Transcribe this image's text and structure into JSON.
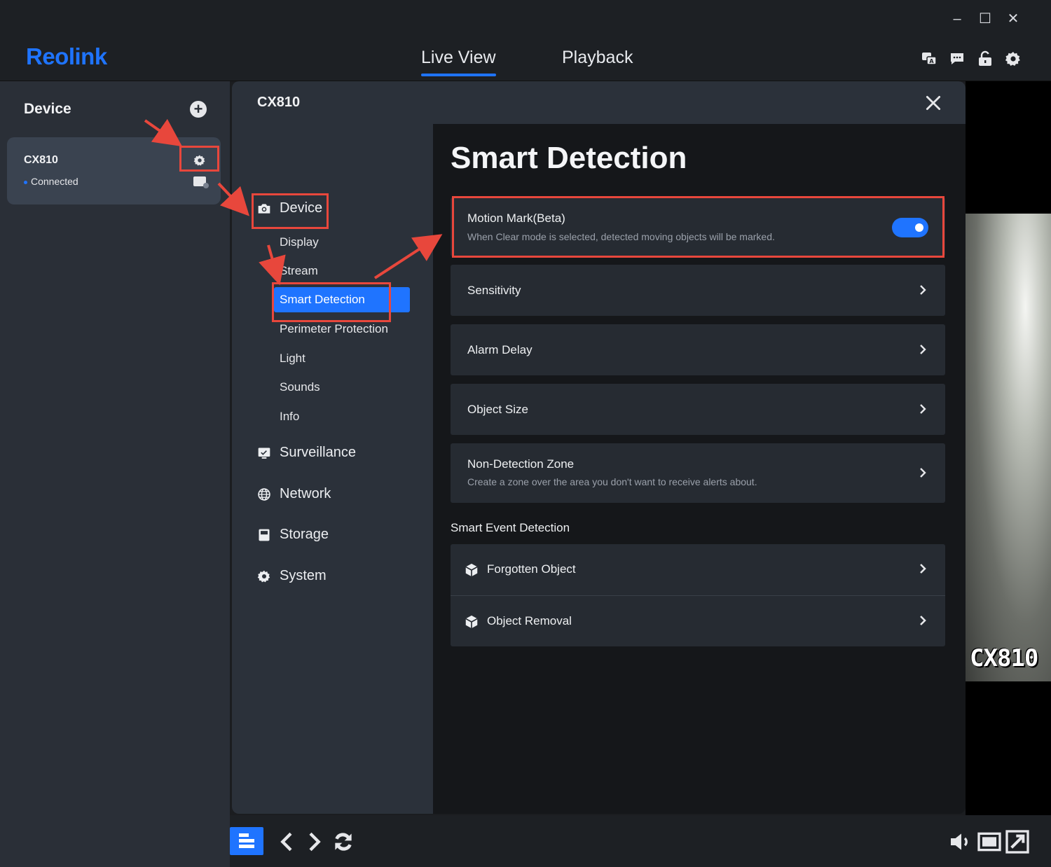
{
  "window": {
    "minimize": "–",
    "maximize": "☐",
    "close": "✕"
  },
  "app": {
    "logo": "Reolink",
    "tabs": [
      {
        "label": "Live View",
        "active": true
      },
      {
        "label": "Playback",
        "active": false
      }
    ]
  },
  "left_panel": {
    "title": "Device",
    "devices": [
      {
        "name": "CX810",
        "status": "Connected"
      }
    ]
  },
  "modal": {
    "title": "CX810",
    "nav": [
      {
        "label": "Device",
        "icon": "camera-icon"
      },
      {
        "label": "Display"
      },
      {
        "label": "Stream"
      },
      {
        "label": "Smart Detection",
        "active": true
      },
      {
        "label": "Perimeter Protection"
      },
      {
        "label": "Light"
      },
      {
        "label": "Sounds"
      },
      {
        "label": "Info"
      },
      {
        "label": "Surveillance",
        "icon": "monitor-icon"
      },
      {
        "label": "Network",
        "icon": "globe-icon"
      },
      {
        "label": "Storage",
        "icon": "storage-icon"
      },
      {
        "label": "System",
        "icon": "gear-icon"
      }
    ],
    "content": {
      "title": "Smart Detection",
      "motion_mark": {
        "label": "Motion Mark(Beta)",
        "description": "When Clear mode is selected, detected moving objects will be marked.",
        "enabled": true
      },
      "rows": [
        {
          "label": "Sensitivity"
        },
        {
          "label": "Alarm Delay"
        },
        {
          "label": "Object Size"
        },
        {
          "label": "Non-Detection Zone",
          "description": "Create a zone over the area you don't want to receive alerts about."
        }
      ],
      "section": "Smart Event Detection",
      "events": [
        {
          "label": "Forgotten Object",
          "icon": "cube-icon"
        },
        {
          "label": "Object Removal",
          "icon": "cube-icon"
        }
      ]
    }
  },
  "video": {
    "label": "CX810"
  },
  "colors": {
    "accent": "#1f74ff",
    "annotation": "#e8473c"
  }
}
